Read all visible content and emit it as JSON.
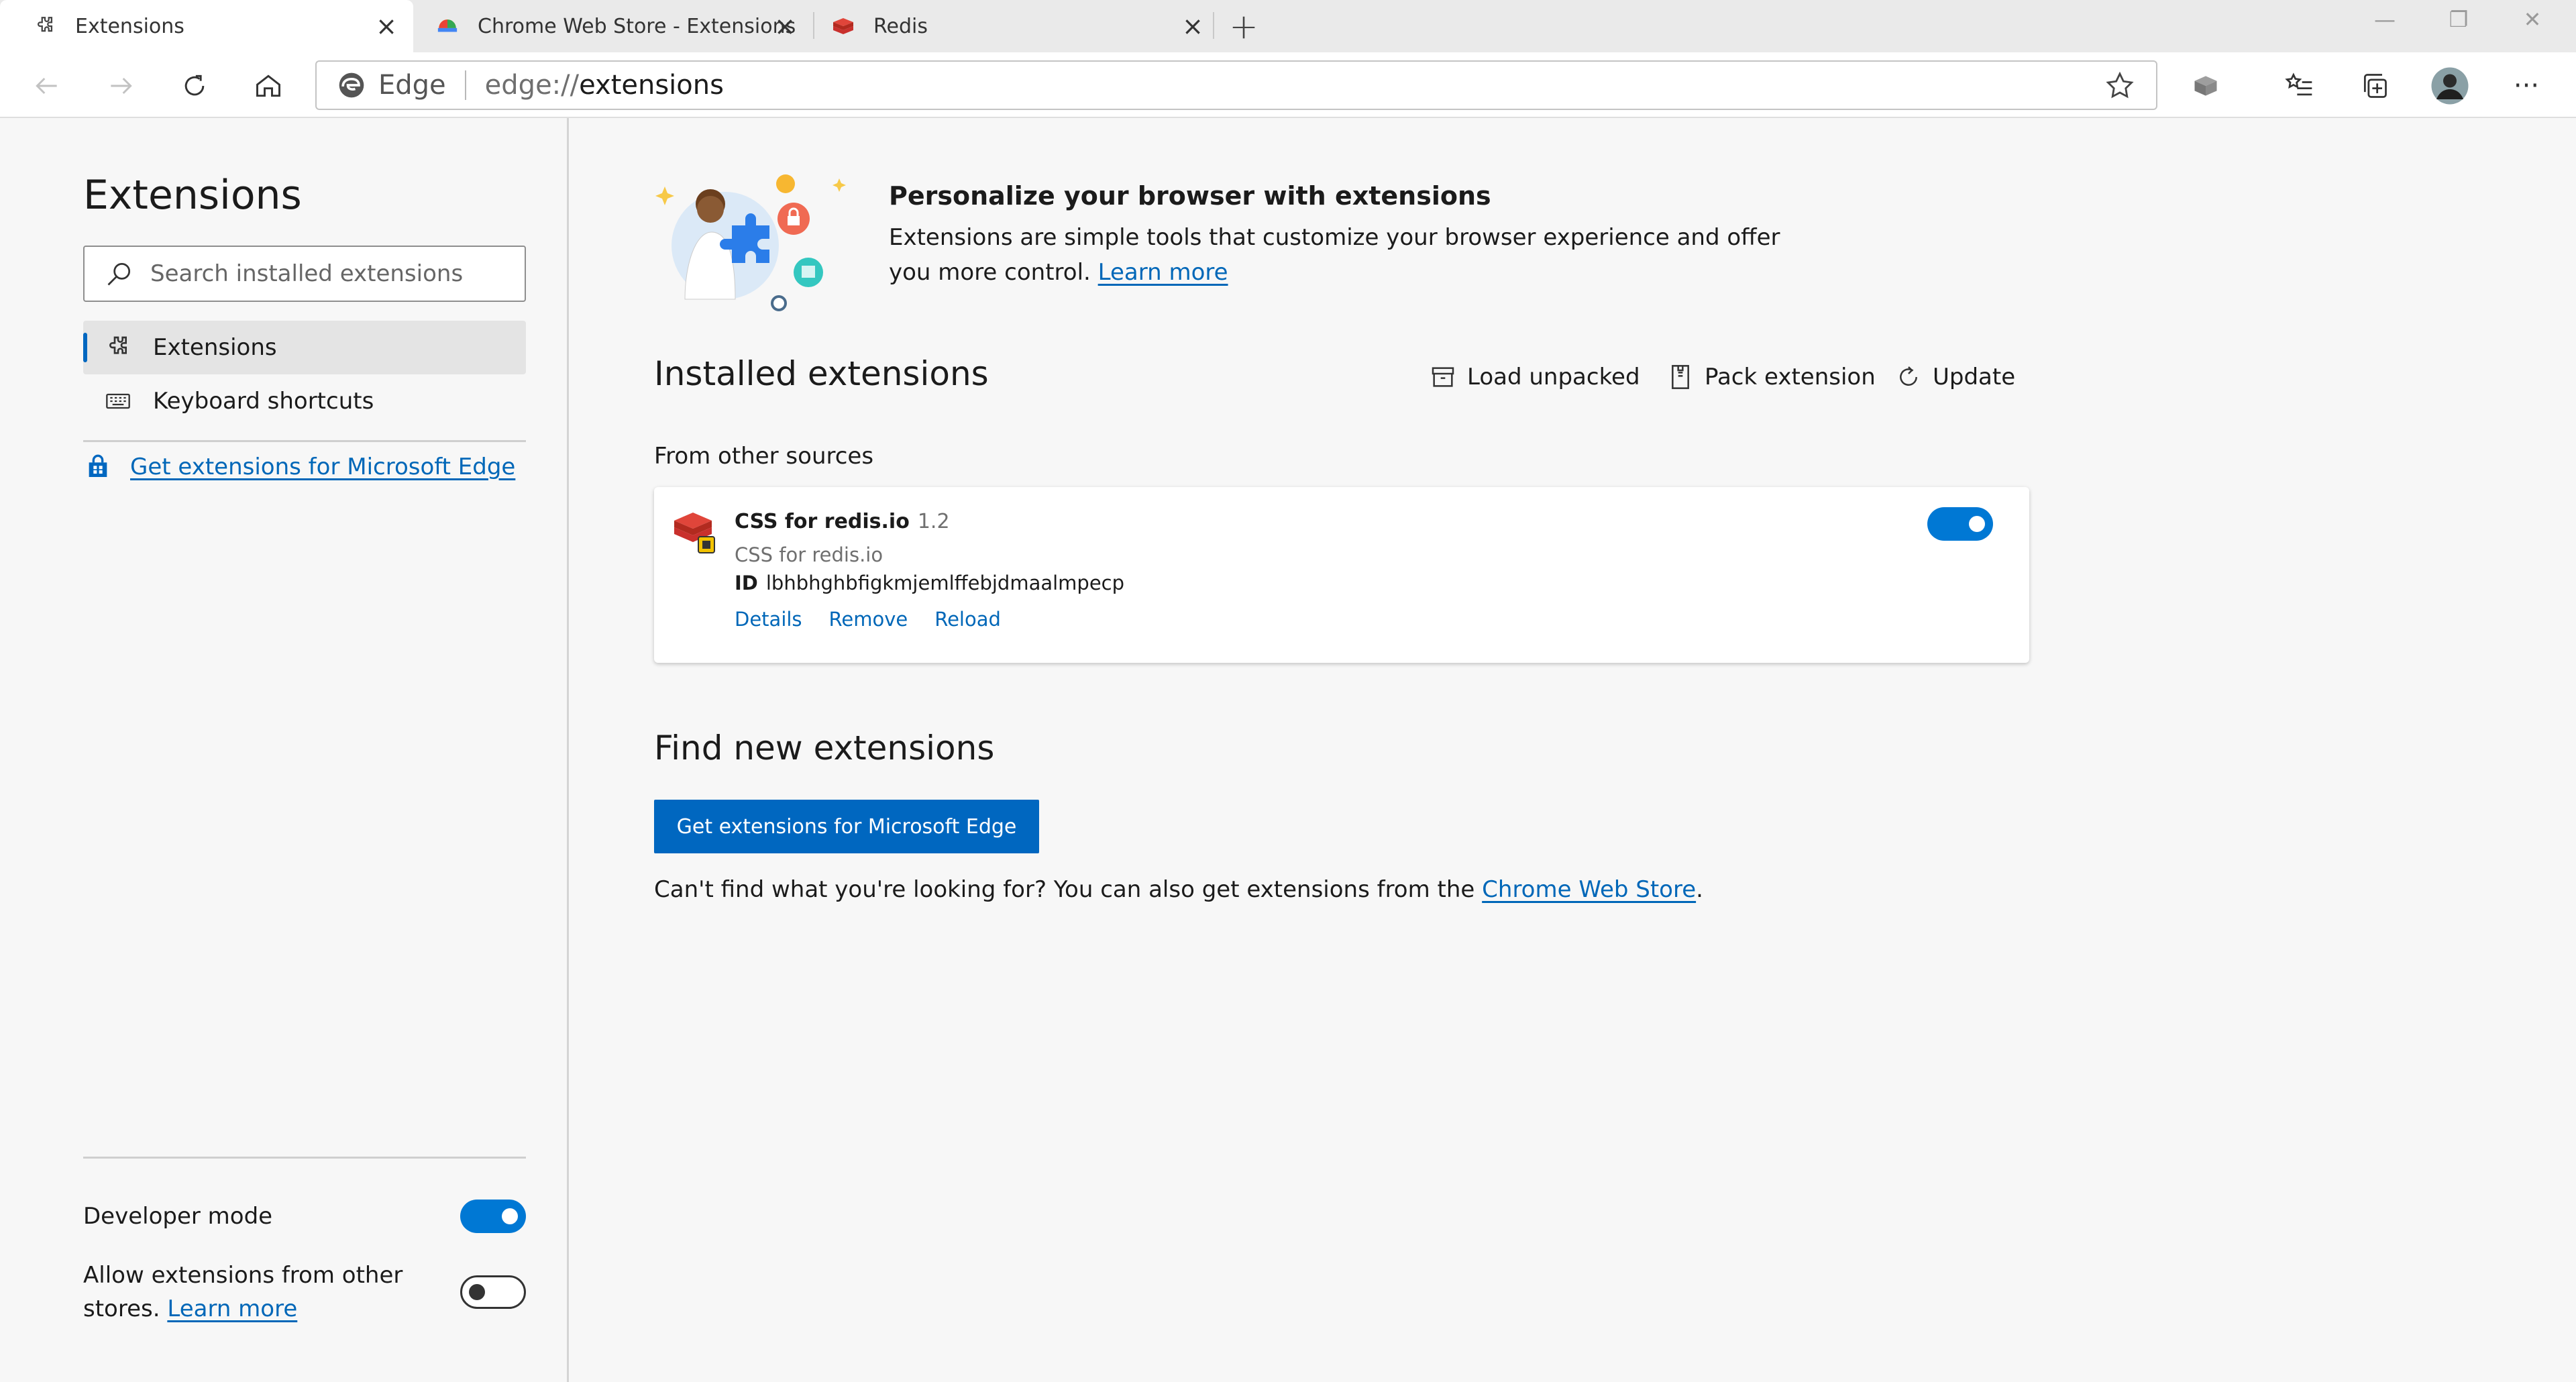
{
  "tabs": [
    {
      "label": "Extensions",
      "icon": "puzzle-icon",
      "active": true
    },
    {
      "label": "Chrome Web Store - Extensions",
      "icon": "chrome-web-store-icon",
      "active": false
    },
    {
      "label": "Redis",
      "icon": "redis-icon",
      "active": false
    }
  ],
  "new_tab_glyph": "+",
  "window_controls": {
    "minimize": "—",
    "restore": "❐",
    "close": "✕"
  },
  "address_bar": {
    "brand": "Edge",
    "url_scheme": "edge://",
    "url_path": "extensions"
  },
  "sidebar": {
    "title": "Extensions",
    "search_placeholder": "Search installed extensions",
    "nav": [
      {
        "label": "Extensions",
        "icon": "puzzle-icon",
        "selected": true
      },
      {
        "label": "Keyboard shortcuts",
        "icon": "keyboard-icon",
        "selected": false
      }
    ],
    "get_extensions_link": "Get extensions for Microsoft Edge",
    "developer_mode_label": "Developer mode",
    "developer_mode_on": true,
    "allow_other_stores_text": "Allow extensions from other stores.",
    "allow_other_stores_link": "Learn more",
    "allow_other_stores_on": false
  },
  "hero": {
    "title": "Personalize your browser with extensions",
    "text": "Extensions are simple tools that customize your browser experience and offer you more control.",
    "link": "Learn more"
  },
  "installed": {
    "title": "Installed extensions",
    "actions": [
      {
        "label": "Load unpacked",
        "icon": "box-icon"
      },
      {
        "label": "Pack extension",
        "icon": "archive-icon"
      },
      {
        "label": "Update",
        "icon": "refresh-icon"
      }
    ],
    "group_label": "From other sources",
    "extension": {
      "name": "CSS for redis.io",
      "version": "1.2",
      "description": "CSS for redis.io",
      "id_label": "ID",
      "id": "lbhbhghbfigkmjemlffebjdmaalmpecp",
      "links": [
        "Details",
        "Remove",
        "Reload"
      ],
      "enabled": true
    }
  },
  "find": {
    "title": "Find new extensions",
    "button": "Get extensions for Microsoft Edge",
    "text_before": "Can't find what you're looking for? You can also get extensions from the",
    "link": "Chrome Web Store",
    "text_after": "."
  },
  "colors": {
    "accent": "#0067c0",
    "toggle_on": "#0078d4",
    "link": "#0067b8",
    "redis": "#d82c20"
  }
}
